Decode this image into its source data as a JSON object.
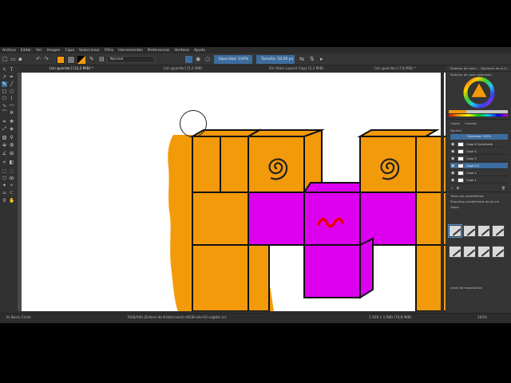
{
  "menu": [
    "Archivo",
    "Editar",
    "Ver",
    "Imagen",
    "Capa",
    "Seleccionar",
    "Filtro",
    "Herramientas",
    "Preferencias",
    "Ventana",
    "Ayuda"
  ],
  "toolbar": {
    "blend_mode": "Normal",
    "opacity_label": "Opacidad: 100%",
    "size_label": "Tamaño: 50,00 px"
  },
  "tabs": [
    "[sin guardar]  (12,2 MiB) *",
    "[sin guardar]  (5,2 MiB)",
    "Sin título  Layer2 Copy (5,2 MiB)",
    "[sin guardar]  (7,8 MiB) *"
  ],
  "dock": {
    "tabs_top": [
      "Selector de color...",
      "Opciones de la h..."
    ],
    "color_selector_label": "Selector de color avanzado",
    "layers_tabs": [
      "Capas",
      "Canales"
    ],
    "blend_label": "Normal",
    "opacity_label": "Opacidad:  100%",
    "layers": [
      {
        "name": "Capa 6 Conectado",
        "active": false
      },
      {
        "name": "Capa 4",
        "active": false
      },
      {
        "name": "Capa 3",
        "active": false
      },
      {
        "name": "Capa 3 C",
        "active": true
      },
      {
        "name": "Capa 2",
        "active": false
      },
      {
        "name": "Capa 1",
        "active": false
      }
    ],
    "brush_tag_label": "Todos los predefinidos",
    "brush_filter_label": "Todos",
    "brush_tag_field": "Etiquetas predefinidas de pincel",
    "bottom_label": "Línea de importación"
  },
  "status": {
    "tool": "b) Basic Circle",
    "color_space": "RGB/Alfa (Entero de 8 bits/canal)  sRGB-elle-V2-srgbtrc.icc",
    "dimensions": "1.920 x 1.080 (74,8 MiB)",
    "zoom": "202%"
  },
  "colors": {
    "orange": "#f39a0b",
    "magenta": "#dd00ee",
    "spiral": "#d96a00",
    "red_squiggle": "#e8000a",
    "accent": "#3d6d9e"
  },
  "icons": [
    "brush-icon",
    "eraser-icon",
    "selection-icon",
    "text-icon",
    "move-icon",
    "fill-icon",
    "zoom-icon",
    "gradient-icon",
    "eyedropper-icon",
    "shape-icon"
  ]
}
